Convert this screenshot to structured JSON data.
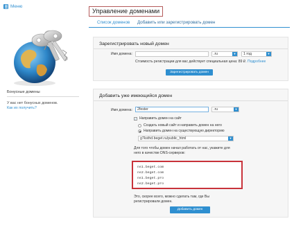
{
  "menu": {
    "label": "Меню",
    "icon": "hamburger-icon"
  },
  "header": {
    "title": "Управление доменами"
  },
  "tabs": [
    {
      "label": "Список доменов"
    },
    {
      "label": "Добавить или зарегистрировать домен"
    }
  ],
  "sidebar": {
    "bonus_title": "Бонусные домены",
    "bonus_text": "У вас нет бонусных доменов.",
    "bonus_link": "Как их получить?"
  },
  "register": {
    "heading": "Зарегистрировать новый домен",
    "name_label": "Имя домена:",
    "name_value": "",
    "zone_value": ".ru",
    "period_value": "1 год",
    "price_text": "Стоимость регистрации для вас действует специальная цена: 89 ₽.",
    "price_link": "Подробнее",
    "button": "Зарегистрировать домен"
  },
  "add": {
    "heading": "Добавить уже имеющийся домен",
    "name_label": "Имя домена:",
    "name_value": "2fester",
    "zone_value": ".ru",
    "direct_label": "Направить домен на сайт",
    "opt_new": "Создать новый сайт и направить домен на него",
    "opt_existing": "Направить домен на существующую директорию",
    "dir_value": "g7ksthd.beget.ru/public_html",
    "dns_note_1": "Для того чтобы домен начал работать от нас, укажите для",
    "dns_note_2": "него в качестве DNS-серверов:",
    "dns": [
      "ns1.beget.com",
      "ns2.beget.com",
      "ns1.beget.pro",
      "ns2.beget.pro"
    ],
    "after_1": "Это, скорее всего, можно сделать там, где Вы",
    "after_2": "регистрировали домен.",
    "button": "Добавить домен"
  },
  "colors": {
    "accent": "#2f8fd0",
    "highlight": "#c8323a"
  }
}
